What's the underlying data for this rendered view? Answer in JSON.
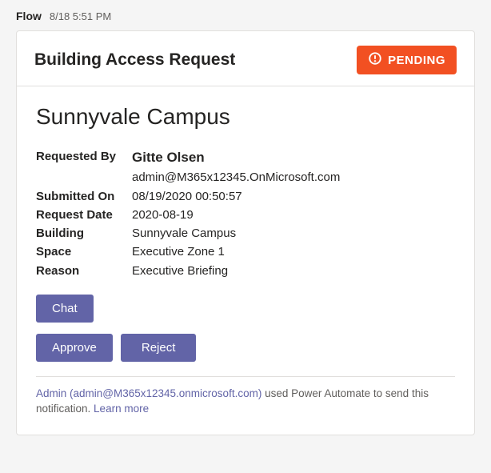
{
  "post": {
    "author": "Flow",
    "timestamp": "8/18 5:51 PM"
  },
  "card": {
    "title": "Building Access Request",
    "status": "PENDING",
    "campus": "Sunnyvale Campus"
  },
  "details": {
    "requested_by_label": "Requested By",
    "requester_name": "Gitte Olsen",
    "requester_email": "admin@M365x12345.OnMicrosoft.com",
    "submitted_label": "Submitted On",
    "submitted_value": "08/19/2020 00:50:57",
    "request_date_label": "Request Date",
    "request_date_value": "2020-08-19",
    "building_label": "Building",
    "building_value": "Sunnyvale Campus",
    "space_label": "Space",
    "space_value": "Executive Zone 1",
    "reason_label": "Reason",
    "reason_value": "Executive Briefing"
  },
  "buttons": {
    "chat": "Chat",
    "approve": "Approve",
    "reject": "Reject"
  },
  "footer": {
    "admin_link": "Admin (admin@M365x12345.onmicrosoft.com)",
    "used_text": " used Power Automate to send this notification. ",
    "learn_more": "Learn more"
  }
}
